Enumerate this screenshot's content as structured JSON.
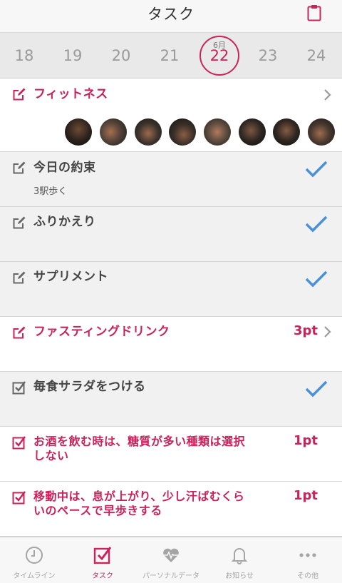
{
  "header": {
    "title": "タスク",
    "clipboard_icon": "clipboard-icon"
  },
  "dates": {
    "month_label": "6月",
    "days": [
      "18",
      "19",
      "20",
      "21",
      "22",
      "23",
      "24"
    ],
    "selected": "22"
  },
  "colors": {
    "accent": "#c8245a",
    "check": "#4a90d9",
    "grey_row": "#f1f1f1"
  },
  "tasks": [
    {
      "title": "フィットネス",
      "icon": "edit-icon",
      "style": "pink",
      "trailing": "chevron"
    },
    {
      "title": "今日の約束",
      "subtitle": "3駅歩く",
      "icon": "edit-icon",
      "style": "dark",
      "trailing": "check"
    },
    {
      "title": "ふりかえり",
      "icon": "edit-icon",
      "style": "dark",
      "trailing": "check"
    },
    {
      "title": "サプリメント",
      "icon": "edit-icon",
      "style": "dark",
      "trailing": "check"
    },
    {
      "title": "ファスティングドリンク",
      "icon": "edit-icon",
      "style": "pink",
      "points": "3pt",
      "trailing": "chevron"
    },
    {
      "title": "毎食サラダをつける",
      "icon": "checkbox-checked-icon",
      "style": "dark",
      "trailing": "check"
    },
    {
      "title_line1": "お酒を飲む時は、糖質が多い種類は選択",
      "title_line2": "しない",
      "icon": "checkbox-checked-icon",
      "style": "pink",
      "points": "1pt"
    },
    {
      "title_line1": "移動中は、息が上がり、少し汗ばむくら",
      "title_line2": "いのペースで早歩きする",
      "icon": "checkbox-checked-icon",
      "style": "pink",
      "points": "1pt"
    }
  ],
  "tabbar": {
    "items": [
      {
        "label": "タイムライン",
        "icon": "clock-icon"
      },
      {
        "label": "タスク",
        "icon": "checkbox-icon",
        "active": true
      },
      {
        "label": "パーソナルデータ",
        "icon": "heart-pulse-icon"
      },
      {
        "label": "お知らせ",
        "icon": "bell-icon"
      },
      {
        "label": "その他",
        "icon": "more-icon"
      }
    ]
  }
}
